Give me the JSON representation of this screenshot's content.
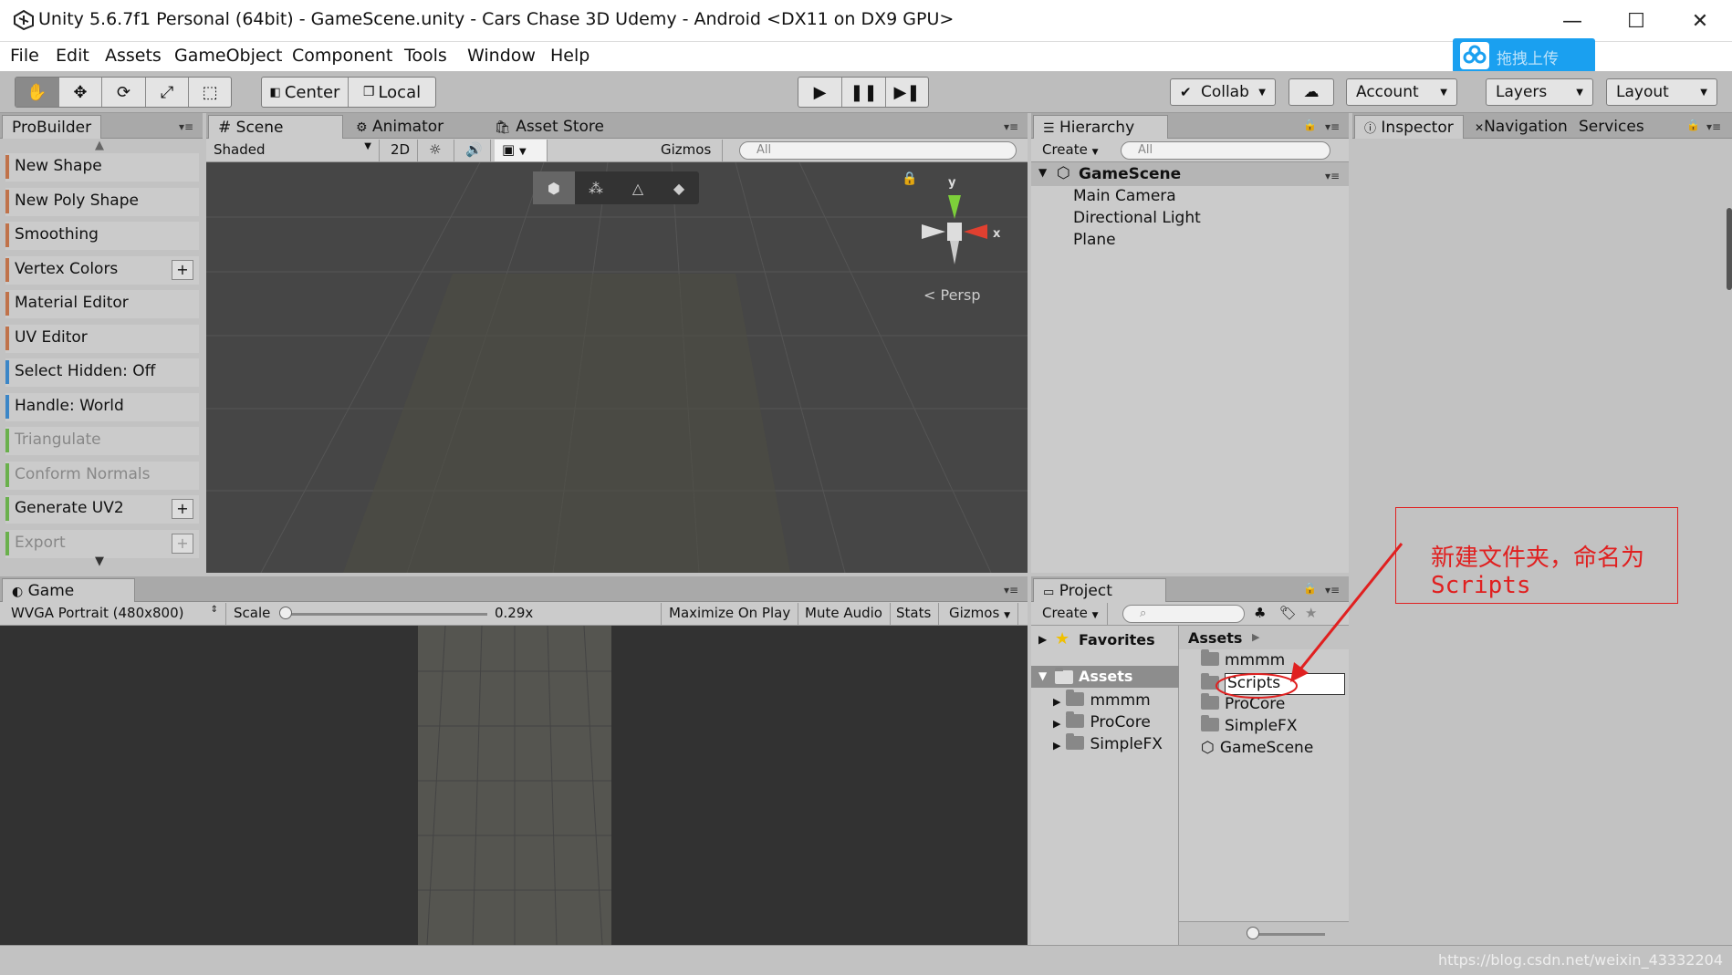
{
  "window": {
    "title": "Unity 5.6.7f1 Personal (64bit) - GameScene.unity - Cars Chase 3D Udemy - Android <DX11 on DX9 GPU>",
    "minimize": "—",
    "maximize": "☐",
    "close": "✕"
  },
  "menu": [
    "File",
    "Edit",
    "Assets",
    "GameObject",
    "Component",
    "Tools",
    "Window",
    "Help"
  ],
  "upload_label": "拖拽上传",
  "toolbar": {
    "center": "Center",
    "local": "Local",
    "collab": "Collab",
    "account": "Account",
    "layers": "Layers",
    "layout": "Layout"
  },
  "probuilder": {
    "tab": "ProBuilder",
    "items": [
      {
        "label": "New Shape",
        "color": "#c0724a",
        "plus": false,
        "dim": false
      },
      {
        "label": "New Poly Shape",
        "color": "#c0724a",
        "plus": false,
        "dim": false
      },
      {
        "label": "Smoothing",
        "color": "#c0724a",
        "plus": false,
        "dim": false
      },
      {
        "label": "Vertex Colors",
        "color": "#c0724a",
        "plus": true,
        "dim": false
      },
      {
        "label": "Material Editor",
        "color": "#c0724a",
        "plus": false,
        "dim": false
      },
      {
        "label": "UV Editor",
        "color": "#c0724a",
        "plus": false,
        "dim": false
      },
      {
        "label": "Select Hidden: Off",
        "color": "#3b86c7",
        "plus": false,
        "dim": false
      },
      {
        "label": "Handle: World",
        "color": "#3b86c7",
        "plus": false,
        "dim": false
      },
      {
        "label": "Triangulate",
        "color": "#6ab04c",
        "plus": false,
        "dim": true
      },
      {
        "label": "Conform Normals",
        "color": "#6ab04c",
        "plus": false,
        "dim": true
      },
      {
        "label": "Generate UV2",
        "color": "#6ab04c",
        "plus": true,
        "dim": false
      },
      {
        "label": "Export",
        "color": "#6ab04c",
        "plus": true,
        "dim": true
      }
    ]
  },
  "scene": {
    "tabs": [
      "Scene",
      "Animator",
      "Asset Store"
    ],
    "shaded": "Shaded",
    "mode2d": "2D",
    "gizmos": "Gizmos",
    "search_placeholder": "All",
    "persp": "Persp",
    "axis_y": "y",
    "axis_x": "x"
  },
  "hierarchy": {
    "tab": "Hierarchy",
    "create": "Create",
    "search_placeholder": "All",
    "scene": "GameScene",
    "items": [
      "Main Camera",
      "Directional Light",
      "Plane"
    ]
  },
  "inspector": {
    "tabs": [
      "Inspector",
      "Navigation",
      "Services"
    ]
  },
  "game": {
    "tab": "Game",
    "resolution": "WVGA Portrait (480x800)",
    "scale_label": "Scale",
    "scale_value": "0.29x",
    "buttons": [
      "Maximize On Play",
      "Mute Audio",
      "Stats",
      "Gizmos"
    ]
  },
  "project": {
    "tab": "Project",
    "create": "Create",
    "favorites": "Favorites",
    "assets_label": "Assets",
    "tree": [
      "mmmm",
      "ProCore",
      "SimpleFX"
    ],
    "breadcrumb": "Assets",
    "files": [
      {
        "name": "mmmm",
        "kind": "folder"
      },
      {
        "name": "Scripts",
        "kind": "folder-rename"
      },
      {
        "name": "ProCore",
        "kind": "folder"
      },
      {
        "name": "SimpleFX",
        "kind": "folder"
      },
      {
        "name": "GameScene",
        "kind": "scene"
      }
    ]
  },
  "annotation": {
    "line1": "新建文件夹，命名为",
    "line2": "Scripts",
    "color": "#e02020"
  },
  "watermark": "https://blog.csdn.net/weixin_43332204"
}
